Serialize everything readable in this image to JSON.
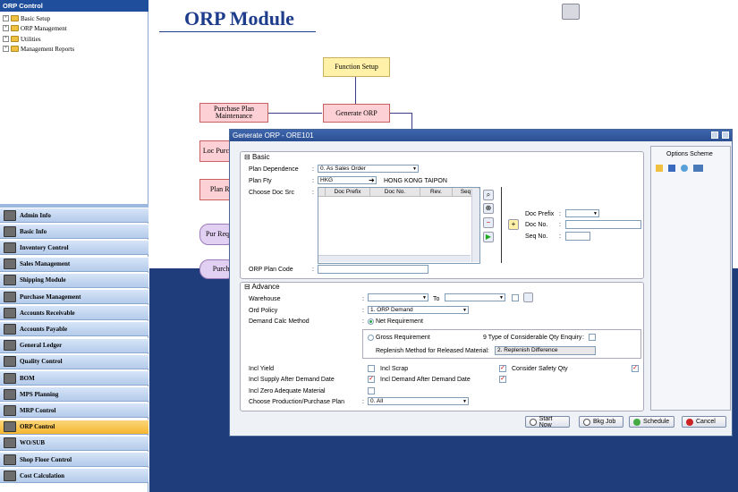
{
  "tree": {
    "header": "ORP Control",
    "nodes": [
      "Basic Setup",
      "ORP Management",
      "Utilities",
      "Management Reports"
    ]
  },
  "nav": [
    {
      "label": "Admin Info",
      "active": false
    },
    {
      "label": "Basic Info",
      "active": false
    },
    {
      "label": "Inventory Control",
      "active": false
    },
    {
      "label": "Sales Management",
      "active": false
    },
    {
      "label": "Shipping Module",
      "active": false
    },
    {
      "label": "Purchase Management",
      "active": false
    },
    {
      "label": "Accounts Receivable",
      "active": false
    },
    {
      "label": "Accounts Payable",
      "active": false
    },
    {
      "label": "General Ledger",
      "active": false
    },
    {
      "label": "Quality Control",
      "active": false
    },
    {
      "label": "BOM",
      "active": false
    },
    {
      "label": "MPS Planning",
      "active": false
    },
    {
      "label": "MRP Control",
      "active": false
    },
    {
      "label": "ORP Control",
      "active": true
    },
    {
      "label": "WO/SUB",
      "active": false
    },
    {
      "label": "Shop Floor Control",
      "active": false
    },
    {
      "label": "Cost Calculation",
      "active": false
    }
  ],
  "main": {
    "title": "ORP Module",
    "boxes": {
      "function_setup": "Function Setup",
      "generate_orp": "Generate ORP",
      "purchase_plan": "Purchase Plan Maintenance",
      "loc": "Loc Purch",
      "plan": "Plan Re",
      "pur": "Pur Requ",
      "purcha": "Purcha"
    }
  },
  "dialog": {
    "title": "Generate ORP - ORE101",
    "basic": {
      "header": "Basic",
      "plan_dependence_label": "Plan Dependence",
      "plan_dependence": "0. As Sales Order",
      "plan_fty_label": "Plan Fty",
      "plan_fty": "HKG",
      "plan_fty_name": "HONG KONG TAIPON",
      "choose_doc_label": "Choose Doc Src",
      "grid_cols": [
        "Doc Prefix",
        "Doc No.",
        "Rev.",
        "Seq"
      ],
      "doc_prefix_label": "Doc Prefix",
      "doc_no_label": "Doc No.",
      "seq_no_label": "Seq No.",
      "orp_plan_code_label": "ORP Plan Code"
    },
    "advance": {
      "header": "Advance",
      "warehouse_label": "Warehouse",
      "to_label": "To",
      "ord_policy_label": "Ord Policy",
      "ord_policy": "1. ORP Demand",
      "demand_calc_label": "Demand Calc Method",
      "net_req": "Net Requirement",
      "gross_req": "Gross Requirement",
      "type_enquiry_label": "9 Type of Considerable Qty Enquiry",
      "replenish_label": "Replenish Method for Released Material:",
      "replenish_value": "2. Replenish Difference",
      "incl_yield": "Incl Yield",
      "incl_scrap": "Incl Scrap",
      "consider_safety": "Consider Safety Qty",
      "incl_supply_after": "Incl Supply After Demand Date",
      "incl_demand_after": "Incl Demand After Demand Date",
      "incl_zero": "Incl Zero Adequate Material",
      "choose_prod_label": "Choose Production/Purchase Plan",
      "choose_prod_value": "0. All"
    },
    "options_scheme": "Options Scheme",
    "buttons": {
      "start_now": "Start Now",
      "bkg_job": "Bkg Job",
      "schedule": "Schedule",
      "cancel": "Cancel"
    }
  },
  "colors": {
    "nav_active": "#f5b630",
    "title_blue": "#1e3c8c",
    "dialog_title": "#2b4f92"
  }
}
